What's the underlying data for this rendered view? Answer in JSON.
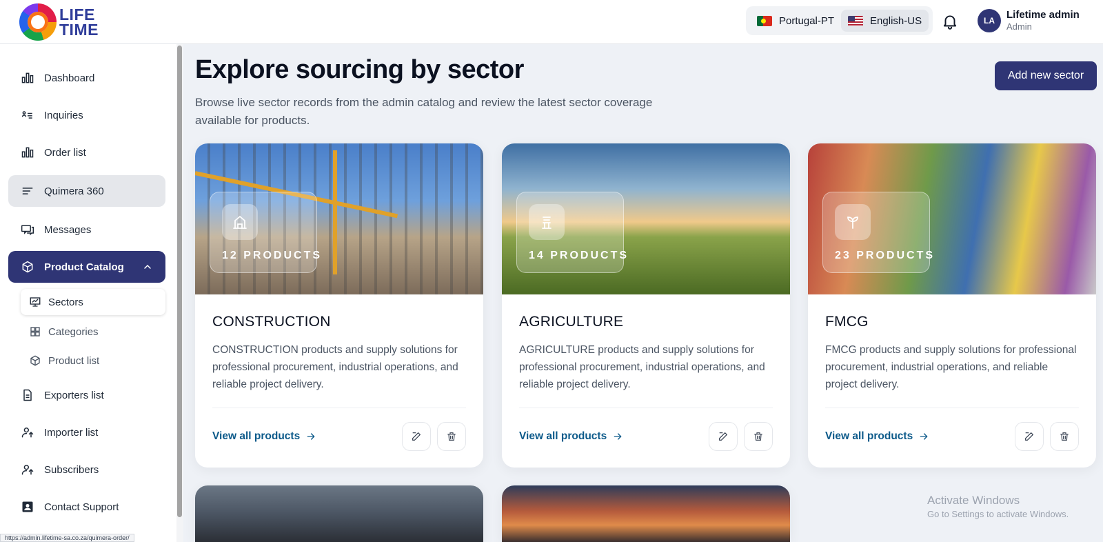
{
  "header": {
    "logo_line1": "LIFE",
    "logo_line2": "TIME",
    "languages": [
      {
        "label": "Portugal-PT",
        "active": false
      },
      {
        "label": "English-US",
        "active": true
      }
    ],
    "user": {
      "initials": "LA",
      "name": "Lifetime admin",
      "role": "Admin"
    }
  },
  "sidebar": {
    "items": [
      {
        "label": "Dashboard",
        "icon": "bar-chart-icon"
      },
      {
        "label": "Inquiries",
        "icon": "inquiries-icon"
      },
      {
        "label": "Order list",
        "icon": "bar-chart-icon"
      },
      {
        "label": "Quimera 360",
        "icon": "lines-icon"
      },
      {
        "label": "Messages",
        "icon": "messages-icon"
      },
      {
        "label": "Product Catalog",
        "icon": "box-icon"
      },
      {
        "label": "Exporters list",
        "icon": "document-icon"
      },
      {
        "label": "Importer list",
        "icon": "user-share-icon"
      },
      {
        "label": "Subscribers",
        "icon": "user-share-icon"
      },
      {
        "label": "Contact Support",
        "icon": "contact-card-icon"
      }
    ],
    "sub_items": [
      {
        "label": "Sectors",
        "icon": "presentation-chart-icon"
      },
      {
        "label": "Categories",
        "icon": "grid-icon"
      },
      {
        "label": "Product list",
        "icon": "box-icon"
      }
    ],
    "status_url": "https://admin.lifetime-sa.co.za/quimera-order/"
  },
  "main": {
    "title": "Explore sourcing by sector",
    "subtitle": "Browse live sector records from the admin catalog and review the latest sector coverage available for products.",
    "add_button": "Add new sector",
    "cards": [
      {
        "title": "CONSTRUCTION",
        "count": "12 PRODUCTS",
        "description": "CONSTRUCTION products and supply solutions for professional procurement, industrial operations, and reliable project delivery.",
        "link": "View all products"
      },
      {
        "title": "AGRICULTURE",
        "count": "14 PRODUCTS",
        "description": "AGRICULTURE products and supply solutions for professional procurement, industrial operations, and reliable project delivery.",
        "link": "View all products"
      },
      {
        "title": "FMCG",
        "count": "23 PRODUCTS",
        "description": "FMCG products and supply solutions for professional procurement, industrial operations, and reliable project delivery.",
        "link": "View all products"
      }
    ]
  },
  "watermark": {
    "title": "Activate Windows",
    "subtitle": "Go to Settings to activate Windows."
  },
  "colors": {
    "primary": "#2f3575",
    "link": "#0c5a8a",
    "background": "#eef1f6"
  }
}
